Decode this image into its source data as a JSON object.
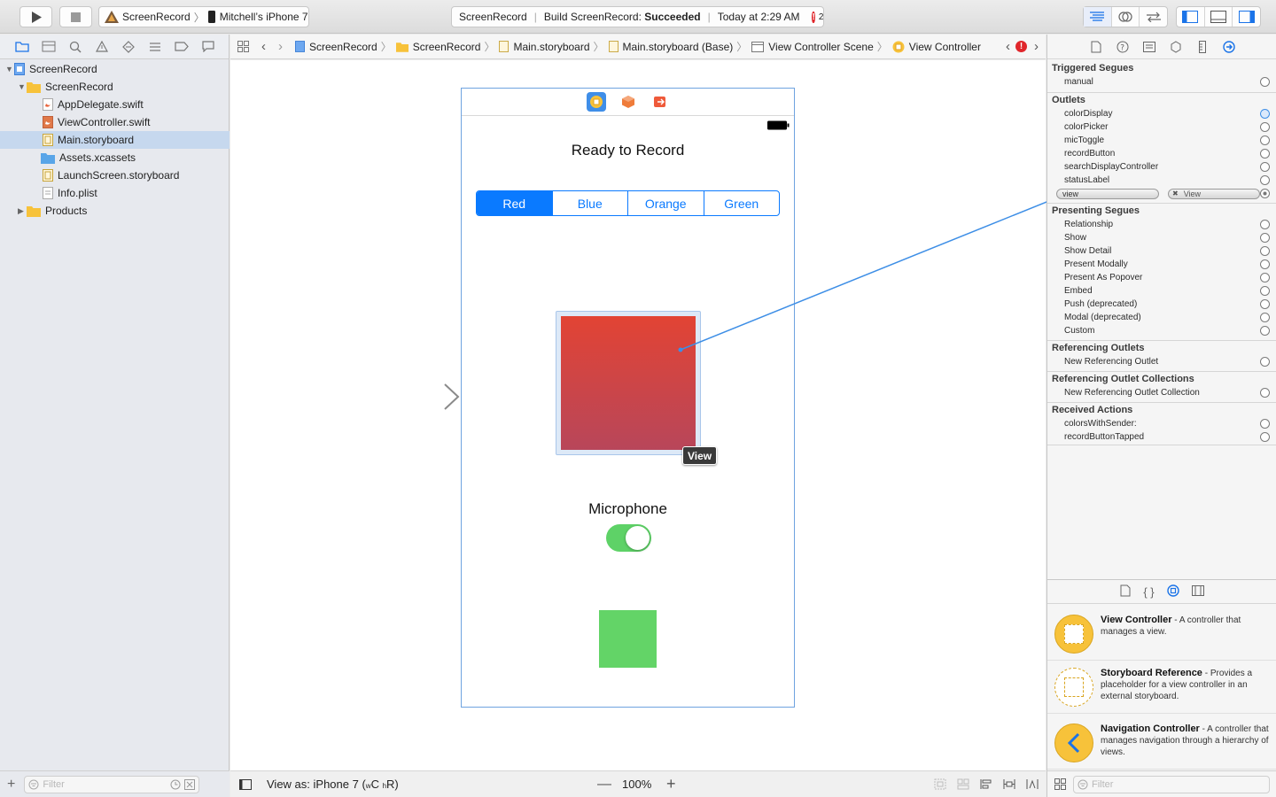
{
  "toolbar": {
    "scheme_name": "ScreenRecord",
    "device_name": "Mitchell’s iPhone 7",
    "activity_project": "ScreenRecord",
    "activity_build_prefix": "Build ScreenRecord:",
    "activity_build_status": "Succeeded",
    "activity_time": "Today at 2:29 AM",
    "issue_count": "2"
  },
  "navigator": {
    "items": [
      {
        "label": "ScreenRecord",
        "kind": "project"
      },
      {
        "label": "ScreenRecord",
        "kind": "folder"
      },
      {
        "label": "AppDelegate.swift",
        "kind": "swift"
      },
      {
        "label": "ViewController.swift",
        "kind": "swift"
      },
      {
        "label": "Main.storyboard",
        "kind": "storyboard"
      },
      {
        "label": "Assets.xcassets",
        "kind": "assets"
      },
      {
        "label": "LaunchScreen.storyboard",
        "kind": "storyboard"
      },
      {
        "label": "Info.plist",
        "kind": "plist"
      },
      {
        "label": "Products",
        "kind": "folder"
      }
    ],
    "filter_placeholder": "Filter"
  },
  "jumpbar": {
    "crumbs": [
      "ScreenRecord",
      "ScreenRecord",
      "Main.storyboard",
      "Main.storyboard (Base)",
      "View Controller Scene",
      "View Controller"
    ]
  },
  "scene": {
    "title": "Ready to Record",
    "segments": [
      "Red",
      "Blue",
      "Orange",
      "Green"
    ],
    "selected_segment": "Red",
    "microphone_label": "Microphone",
    "toggle_on": true,
    "tooltip": "View"
  },
  "editor_bottom": {
    "view_as_prefix": "View as: iPhone 7 (",
    "wc": "w",
    "c": "C",
    "hr": "h",
    "r": "R)",
    "zoom": "100%"
  },
  "inspector": {
    "triggered_segues_title": "Triggered Segues",
    "triggered_segues": [
      "manual"
    ],
    "outlets_title": "Outlets",
    "outlets": [
      "colorDisplay",
      "colorPicker",
      "micToggle",
      "recordButton",
      "searchDisplayController",
      "statusLabel",
      "view"
    ],
    "view_connection_target": "View",
    "presenting_segues_title": "Presenting Segues",
    "presenting_segues": [
      "Relationship",
      "Show",
      "Show Detail",
      "Present Modally",
      "Present As Popover",
      "Embed",
      "Push (deprecated)",
      "Modal (deprecated)",
      "Custom"
    ],
    "referencing_outlets_title": "Referencing Outlets",
    "referencing_outlets": [
      "New Referencing Outlet"
    ],
    "referencing_collections_title": "Referencing Outlet Collections",
    "referencing_collections": [
      "New Referencing Outlet Collection"
    ],
    "received_actions_title": "Received Actions",
    "received_actions": [
      "colorsWithSender:",
      "recordButtonTapped"
    ]
  },
  "library": {
    "items": [
      {
        "name": "View Controller",
        "desc": " - A controller that manages a view."
      },
      {
        "name": "Storyboard Reference",
        "desc": " - Provides a placeholder for a view controller in an external storyboard."
      },
      {
        "name": "Navigation Controller",
        "desc": " - A controller that manages navigation through a hierarchy of views."
      }
    ],
    "filter_placeholder": "Filter"
  },
  "colors": {
    "accent": "#0a7aff",
    "selection": "#c6d8ee",
    "red_gradient_top": "#e24434",
    "red_gradient_bottom": "#b8465a",
    "green_toggle": "#5ed267",
    "green_box": "#63d467",
    "error": "#e0262b",
    "folder": "#f7c23a"
  }
}
